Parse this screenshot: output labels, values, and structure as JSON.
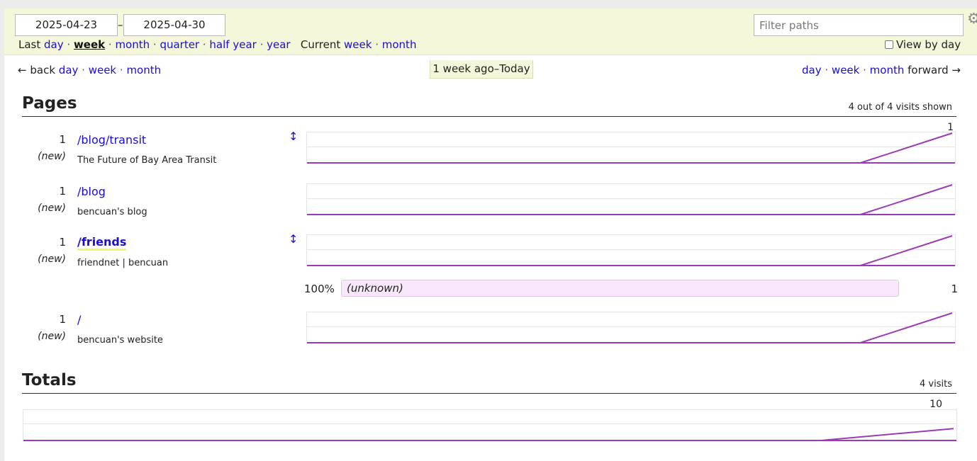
{
  "filters": {
    "start_date": "2025-04-23",
    "separator": "–",
    "end_date": "2025-04-30",
    "filter_placeholder": "Filter paths",
    "last_label": "Last",
    "current_label": "Current",
    "last_ranges": [
      "day",
      "week",
      "month",
      "quarter",
      "half year",
      "year"
    ],
    "active_range": "week",
    "current_ranges": [
      "week",
      "month"
    ],
    "view_by_day": "View by day",
    "view_by_day_checked": false
  },
  "nav": {
    "back_arrow": "←",
    "back_label": "back",
    "back_links": [
      "day",
      "week",
      "month"
    ],
    "forward_links": [
      "day",
      "week",
      "month"
    ],
    "forward_label": "forward",
    "forward_arrow": "→",
    "period": "1 week ago–Today"
  },
  "pages_section": {
    "title": "Pages",
    "summary": "4 out of 4 visits shown",
    "chart_max": "1",
    "rows": [
      {
        "count": "1",
        "new": "(new)",
        "path": "/blog/transit",
        "title": "The Future of Bay Area Transit",
        "expandable": true,
        "highlighted": false
      },
      {
        "count": "1",
        "new": "(new)",
        "path": "/blog",
        "title": "bencuan's blog",
        "expandable": false,
        "highlighted": false
      },
      {
        "count": "1",
        "new": "(new)",
        "path": "/friends",
        "title": "friendnet | bencuan",
        "expandable": true,
        "highlighted": true
      },
      {
        "count": "1",
        "new": "(new)",
        "path": "/",
        "title": "bencuan's website",
        "expandable": false,
        "highlighted": false
      }
    ],
    "referrer": {
      "percent": "100%",
      "label": "(unknown)",
      "count": "1"
    },
    "expand_icon": "↕"
  },
  "totals_section": {
    "title": "Totals",
    "summary": "4 visits",
    "chart_max": "10"
  },
  "colors": {
    "header_bg": "#f4f7d9",
    "link": "#1a0dd8",
    "chart_line": "#9b3ab5",
    "referrer_bg": "#f9e8fb",
    "highlight": "#f5f56a"
  },
  "icons": {
    "gear": "gear-icon",
    "expand": "expand-vertical-icon",
    "checkbox": "checkbox-icon"
  },
  "chart_data": [
    {
      "type": "line",
      "series": [
        {
          "values": [
            0,
            0,
            0,
            0,
            0,
            0,
            0,
            1
          ]
        }
      ],
      "ylim": [
        0,
        1
      ]
    },
    {
      "type": "line",
      "series": [
        {
          "values": [
            0,
            0,
            0,
            0,
            0,
            0,
            0,
            1
          ]
        }
      ],
      "ylim": [
        0,
        1
      ]
    },
    {
      "type": "line",
      "series": [
        {
          "values": [
            0,
            0,
            0,
            0,
            0,
            0,
            0,
            1
          ]
        }
      ],
      "ylim": [
        0,
        1
      ]
    },
    {
      "type": "line",
      "series": [
        {
          "values": [
            0,
            0,
            0,
            0,
            0,
            0,
            0,
            1
          ]
        }
      ],
      "ylim": [
        0,
        1
      ]
    },
    {
      "type": "line",
      "series": [
        {
          "values": [
            0,
            0,
            0,
            0,
            0,
            0,
            0,
            4
          ]
        }
      ],
      "ylim": [
        0,
        10
      ]
    }
  ]
}
